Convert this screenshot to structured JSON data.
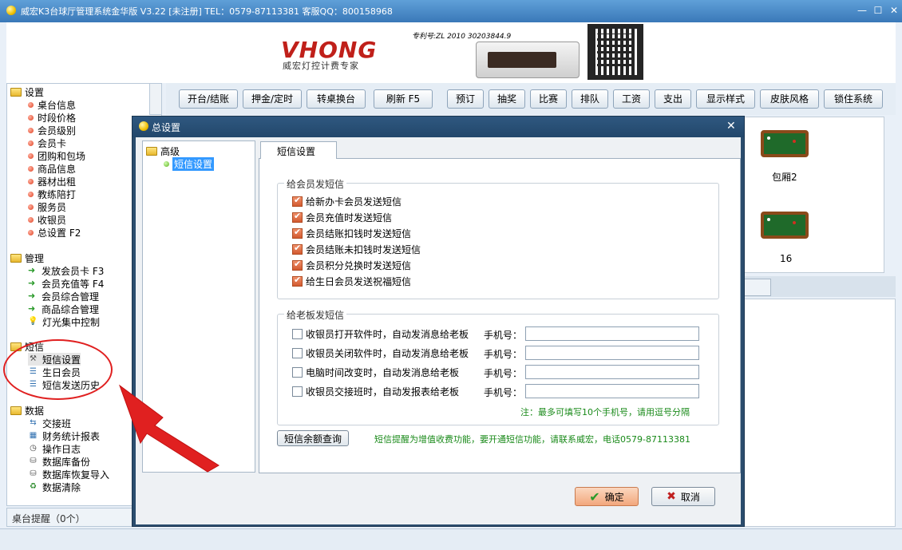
{
  "window": {
    "title": "威宏K3台球厅管理系统金华版 V3.22   [未注册]   TEL：0579-87113381  客服QQ：800158968",
    "min": "—",
    "max": "☐",
    "close": "✕"
  },
  "banner": {
    "logo": "VHONG",
    "slogan": "威宏灯控计费专家",
    "patent": "专利号:ZL 2010 30203844.9"
  },
  "sidebar": {
    "groups": [
      {
        "title": "设置",
        "items": [
          "桌台信息",
          "时段价格",
          "会员级别",
          "会员卡",
          "团购和包场",
          "商品信息",
          "器材出租",
          "教练陪打",
          "服务员",
          "收银员",
          "总设置 F2"
        ]
      },
      {
        "title": "管理",
        "items": [
          "发放会员卡 F3",
          "会员充值等 F4",
          "会员综合管理",
          "商品综合管理",
          "灯光集中控制"
        ]
      },
      {
        "title": "短信",
        "items": [
          "短信设置",
          "生日会员",
          "短信发送历史"
        ]
      },
      {
        "title": "数据",
        "items": [
          "交接班",
          "财务统计报表",
          "操作日志",
          "数据库备份",
          "数据库恢复导入",
          "数据清除"
        ]
      }
    ],
    "status": "桌台提醒（0个）"
  },
  "toolbar": [
    "开台/结账",
    "押金/定时",
    "转桌换台",
    "刷新 F5",
    "预订",
    "抽奖",
    "比赛",
    "排队",
    "工资",
    "支出",
    "显示样式",
    "皮肤风格",
    "锁住系统"
  ],
  "tables": [
    {
      "label": "包厢2"
    },
    {
      "label": "16"
    }
  ],
  "dialog": {
    "title": "总设置",
    "close": "✕",
    "tree_root": "高级",
    "tree_child": "短信设置",
    "tab": "短信设置",
    "member_group": {
      "legend": "给会员发短信",
      "options": [
        {
          "label": "给新办卡会员发送短信",
          "checked": true
        },
        {
          "label": "会员充值时发送短信",
          "checked": true
        },
        {
          "label": "会员结账扣钱时发送短信",
          "checked": true
        },
        {
          "label": "会员结账未扣钱时发送短信",
          "checked": true
        },
        {
          "label": "会员积分兑换时发送短信",
          "checked": true
        },
        {
          "label": "给生日会员发送祝福短信",
          "checked": true
        }
      ]
    },
    "boss_group": {
      "legend": "给老板发短信",
      "phone_label": "手机号：",
      "options": [
        {
          "label": "收银员打开软件时，自动发消息给老板",
          "checked": false,
          "phone": ""
        },
        {
          "label": "收银员关闭软件时，自动发消息给老板",
          "checked": false,
          "phone": ""
        },
        {
          "label": "电脑时间改变时，自动发消息给老板",
          "checked": false,
          "phone": ""
        },
        {
          "label": "收银员交接班时，自动发报表给老板",
          "checked": false,
          "phone": ""
        }
      ],
      "note": "注：最多可填写10个手机号，请用逗号分隔"
    },
    "balance_button": "短信余额查询",
    "notice": "短信提醒为增值收费功能，要开通短信功能，请联系威宏，电话0579-87113381",
    "ok": "确定",
    "cancel": "取消"
  },
  "colors": {
    "annotation": "#e02020",
    "note_green": "#1a8a1a",
    "checkbox_on": "#d25a30"
  }
}
